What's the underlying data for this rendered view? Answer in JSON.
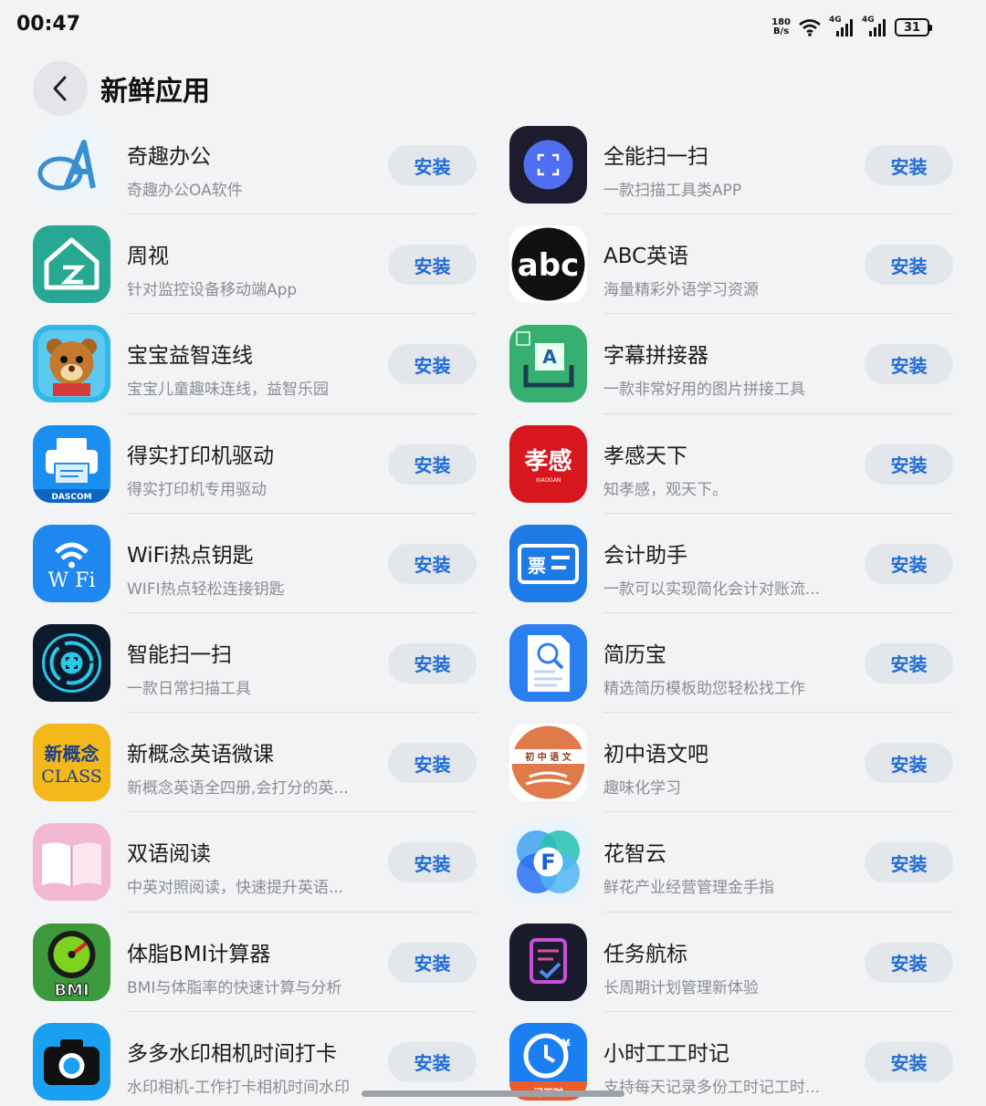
{
  "status_bar": {
    "time": "00:47",
    "net_speed_value": "180",
    "net_speed_unit": "B/s",
    "signal_1": "4G",
    "signal_2": "4G",
    "battery": "31"
  },
  "header": {
    "title": "新鲜应用"
  },
  "install_label": "安装",
  "apps": [
    {
      "name": "奇趣办公",
      "desc": "奇趣办公OA软件",
      "icon": "oa-logo-icon"
    },
    {
      "name": "全能扫一扫",
      "desc": "一款扫描工具类APP",
      "icon": "scan-icon"
    },
    {
      "name": "周视",
      "desc": "针对监控设备移动端App",
      "icon": "house-camera-icon"
    },
    {
      "name": "ABC英语",
      "desc": "海量精彩外语学习资源",
      "icon": "abc-logo-icon"
    },
    {
      "name": "宝宝益智连线",
      "desc": "宝宝儿童趣味连线，益智乐园",
      "icon": "bear-icon"
    },
    {
      "name": "字幕拼接器",
      "desc": "一款非常好用的图片拼接工具",
      "icon": "subtitle-stitch-icon"
    },
    {
      "name": "得实打印机驱动",
      "desc": "得实打印机专用驱动",
      "icon": "printer-icon"
    },
    {
      "name": "孝感天下",
      "desc": "知孝感，观天下。",
      "icon": "xiaogan-logo-icon"
    },
    {
      "name": "WiFi热点钥匙",
      "desc": "WIFI热点轻松连接钥匙",
      "icon": "wifi-icon"
    },
    {
      "name": "会计助手",
      "desc": "一款可以实现简化会计对账流...",
      "icon": "ticket-icon"
    },
    {
      "name": "智能扫一扫",
      "desc": "一款日常扫描工具",
      "icon": "scan-circle-icon"
    },
    {
      "name": "简历宝",
      "desc": "精选简历模板助您轻松找工作",
      "icon": "resume-icon"
    },
    {
      "name": "新概念英语微课",
      "desc": "新概念英语全四册,会打分的英...",
      "icon": "new-concept-class-icon"
    },
    {
      "name": "初中语文吧",
      "desc": "趣味化学习",
      "icon": "chinese-study-icon"
    },
    {
      "name": "双语阅读",
      "desc": "中英对照阅读，快速提升英语...",
      "icon": "book-icon"
    },
    {
      "name": "花智云",
      "desc": "鲜花产业经营管理金手指",
      "icon": "flower-f-icon"
    },
    {
      "name": "体脂BMI计算器",
      "desc": "BMI与体脂率的快速计算与分析",
      "icon": "bmi-gauge-icon"
    },
    {
      "name": "任务航标",
      "desc": "长周期计划管理新体验",
      "icon": "task-check-icon"
    },
    {
      "name": "多多水印相机时间打卡",
      "desc": "水印相机-工作打卡相机时间水印",
      "icon": "camera-icon"
    },
    {
      "name": "小时工工时记",
      "desc": "支持每天记录多份工时记工时...",
      "icon": "clock-yuan-icon"
    }
  ],
  "icon_text": {
    "oa": "A",
    "abc": "abc",
    "xiaogan": "孝感",
    "xiaogan_sub": "XIAOGAN",
    "ticket": "票",
    "dascom": "DASCOM",
    "wifi": "W  Fi",
    "new_concept": "新概念",
    "class": "CLASS",
    "chinese": "初 中 语 文",
    "flower": "F",
    "bmi": "BMI",
    "clock_yuan": "¥",
    "clock_sub": "记工时",
    "stitch": "A"
  },
  "colors": {
    "accent": "#1f6bd6",
    "background": "#f1f3f5",
    "button_bg": "#e3e6ea"
  }
}
